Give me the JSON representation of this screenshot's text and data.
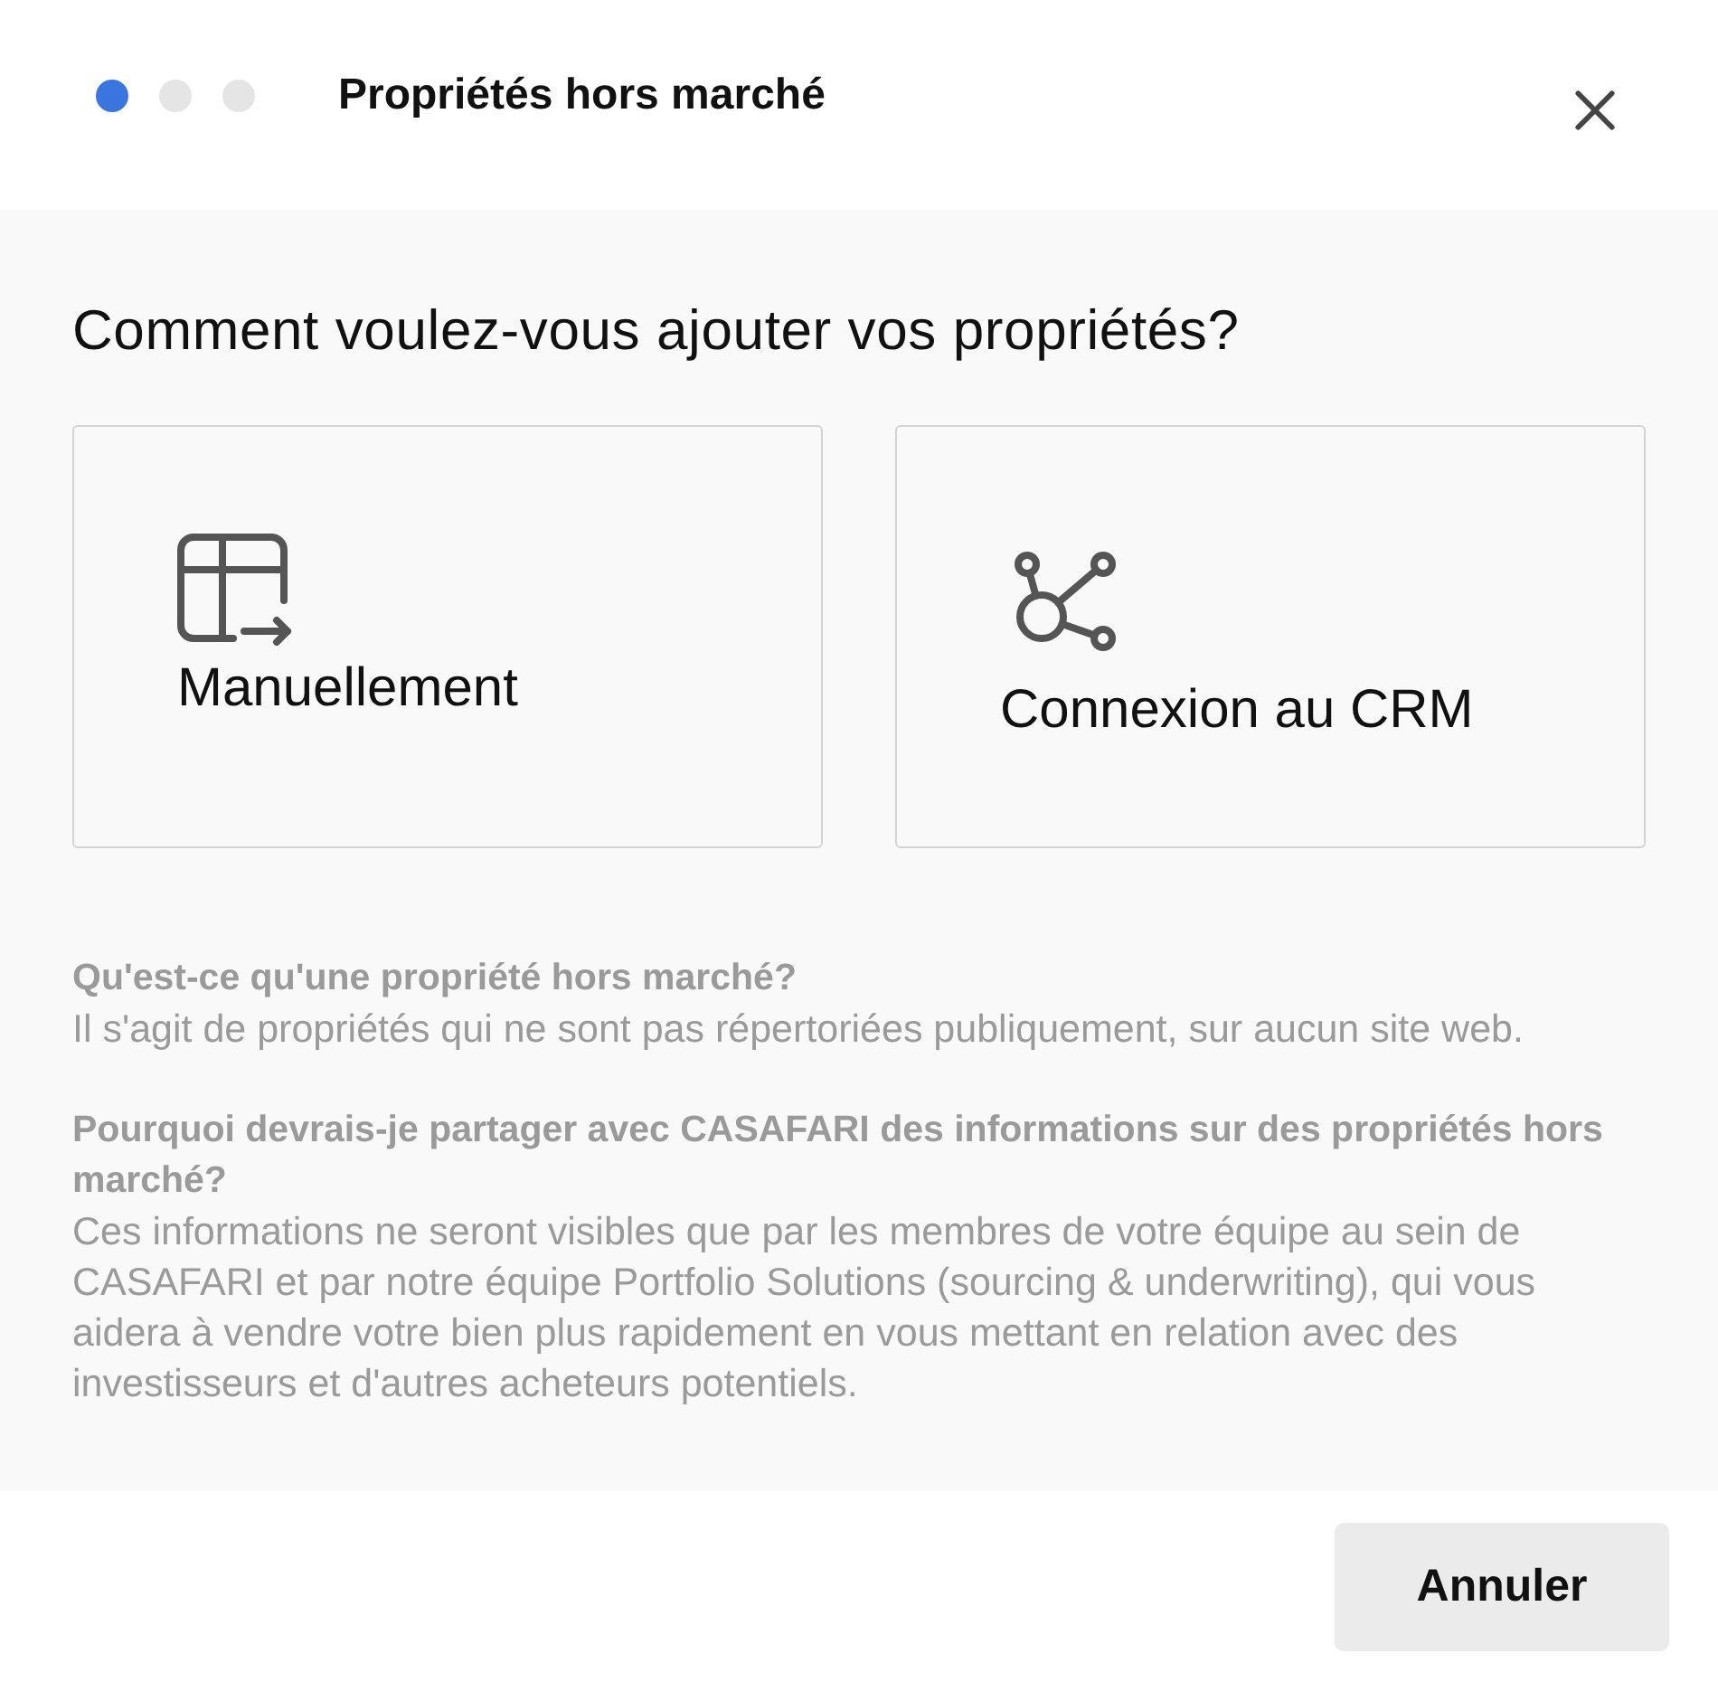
{
  "header": {
    "steps": [
      {
        "current": true
      },
      {
        "current": false
      },
      {
        "current": false
      }
    ],
    "title": "Propriétés hors marché"
  },
  "question": "Comment voulez-vous ajouter vos propriétés?",
  "options": [
    {
      "kind": "table",
      "label": "Manuellement"
    },
    {
      "kind": "network",
      "label": "Connexion au CRM"
    }
  ],
  "faq": [
    {
      "question": "Qu'est-ce qu'une propriété hors marché?",
      "answer": "Il s'agit de propriétés qui ne sont pas répertoriées publiquement, sur aucun site web."
    },
    {
      "question": "Pourquoi devrais-je partager avec CASAFARI des informations sur des propriétés hors marché?",
      "answer": "Ces informations ne seront visibles que par les membres de votre équipe au sein de CASAFARI et par notre équipe Portfolio Solutions (sourcing & underwriting), qui vous aidera à vendre votre bien plus rapidement en vous mettant en relation avec des investisseurs et d'autres acheteurs potentiels."
    }
  ],
  "footer": {
    "cancel_button": "Annuler"
  }
}
